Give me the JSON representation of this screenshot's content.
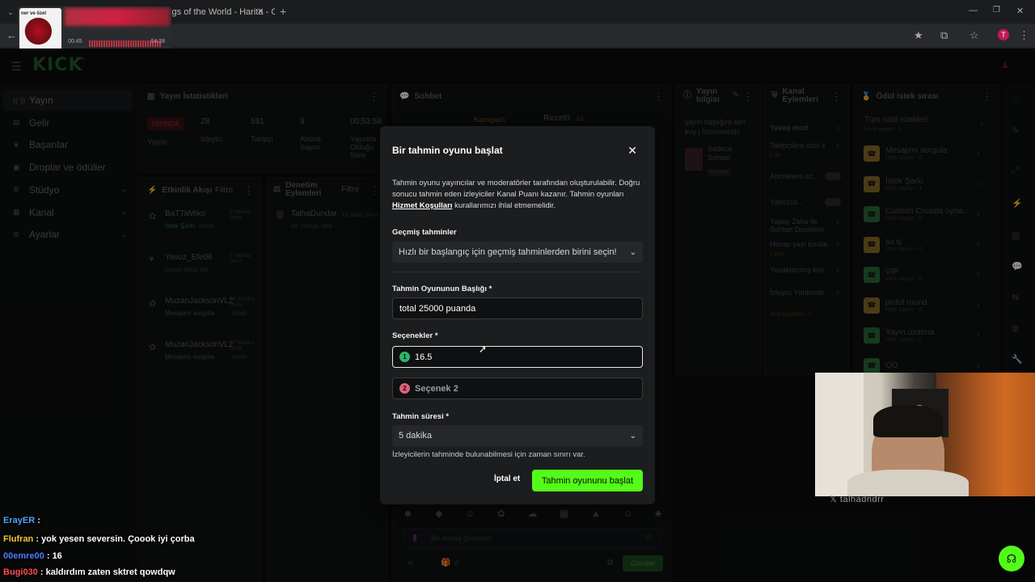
{
  "browser": {
    "tab_title": "lags of the World - Harita - Ga",
    "new_tab": "+",
    "profile_initial": "T"
  },
  "media": {
    "thumb_text": "ner ve özel",
    "time_current": "00:45",
    "time_total": "04:28"
  },
  "app": {
    "logo": "KICK",
    "logo_badge": "beta"
  },
  "sidebar": {
    "items": [
      {
        "label": "Yayın",
        "icon": "broadcast-icon"
      },
      {
        "label": "Gelir",
        "icon": "wallet-icon"
      },
      {
        "label": "Başarılar",
        "icon": "trophy-icon"
      },
      {
        "label": "Droplar ve ödüller",
        "icon": "gift-icon"
      },
      {
        "label": "Stüdyo",
        "icon": "studio-icon"
      },
      {
        "label": "Kanal",
        "icon": "channel-icon"
      },
      {
        "label": "Ayarlar",
        "icon": "gear-icon"
      }
    ]
  },
  "stats": {
    "title": "Yayın İstatistikleri",
    "live_badge": "YAYINDA",
    "live_label": "Yayın",
    "viewers_value": "28",
    "viewers_label": "İzleyici",
    "followers_value": "591",
    "followers_label": "Takipçi",
    "subs_value": "9",
    "subs_label": "Abone Sayısı",
    "uptime_value": "00:53:58",
    "uptime_label": "Yayında Olduğu Süre"
  },
  "activity": {
    "title": "Etkinlik Akışı",
    "filter": "Filtre",
    "items": [
      {
        "user": "BaTTaMiko",
        "time": "6 dakika önce",
        "action": "İstek Şarkı",
        "suffix": "alındı"
      },
      {
        "user": "Yavuz_Efe06",
        "time": "7 dakika önce",
        "action": "kanalı takip etti",
        "suffix": ""
      },
      {
        "user": "MuzanJacksonVL2",
        "time": "46 dakika önce",
        "action": "Mesajımı vurgula",
        "suffix": "alındı"
      },
      {
        "user": "MuzanJacksonVL2",
        "time": "47 dakika önce",
        "action": "Mesajımı vurgula",
        "suffix": "alındı"
      }
    ]
  },
  "moderation": {
    "title": "Denetim Eylemleri",
    "filter": "Filtre",
    "item_user": "TalhaDundar",
    "item_time": "18 saat önce",
    "item_action": "bir mesajı sildi"
  },
  "chat": {
    "title": "Sohbet",
    "user1": "Karogash",
    "user2": "Riccel0",
    "user2_count": "44",
    "input_placeholder": "Bir mesaj gönderin",
    "count": "0",
    "send": "Gönder"
  },
  "stream_info": {
    "title": "Yayın bilgisi",
    "text": "yayın başlığını sen koy | !commands",
    "chat_mode": "Sadece Sohbet",
    "lang": "Turkish"
  },
  "channel_actions": {
    "title": "Kanal Eylemleri",
    "items": [
      "Yavaş mod",
      "Takipçilere özel s",
      "Abonelere öz...",
      "Yalnızca...",
      "Yapay Zeka ile Sohbet Denetimi",
      "Hesap yaşı kısıtla",
      "Yasaklanmış keli",
      "İzleyici Yönlendir"
    ],
    "follower_sub": "1 dk.",
    "age_sub": "1 gün",
    "active_targets": "Aktif hedefler - 1"
  },
  "rewards": {
    "title": "Ödül istek sırası",
    "all_label": "Tüm ödül istekleri",
    "all_count": "İstek sayısı - 3",
    "items": [
      {
        "name": "Mesajımı vurgula",
        "count": "İstek sayısı - 2",
        "color": "#8a6a2a"
      },
      {
        "name": "İstek Şarkı",
        "count": "İstek sayısı - 1",
        "color": "#8a6a2a"
      },
      {
        "name": "Custom Crossla oyna...",
        "count": "İstek sayısı - 0",
        "color": "#2a6a3a"
      },
      {
        "name": "su iç",
        "count": "İstek sayısı - 0",
        "color": "#8a6a2a"
      },
      {
        "name": "VIP",
        "count": "İstek sayısı - 0",
        "color": "#2a6a3a"
      },
      {
        "name": "pistol round",
        "count": "İstek sayısı - 0",
        "color": "#8a6a2a"
      },
      {
        "name": "Yayın uzatma",
        "count": "İstek sayısı - 0",
        "color": "#2a6a3a"
      },
      {
        "name": "OO",
        "count": "",
        "color": "#2a6a3a"
      }
    ]
  },
  "modal": {
    "title": "Bir tahmin oyunu başlat",
    "desc_part1": "Tahmin oyunu yayıncılar ve moderatörler tarafından oluşturulabilir. Doğru sonucu tahmin eden izleyiciler Kanal Puanı kazanır. Tahmin oyunları ",
    "desc_link": "Hizmet Koşulları",
    "desc_part2": " kurallarımızı ihlal etmemelidir.",
    "past_label": "Geçmiş tahminler",
    "past_placeholder": "Hızlı bir başlangıç için geçmiş tahminlerden birini seçin!",
    "title_label": "Tahmin Oyununun Başlığı *",
    "title_value": "total 25000 puanda",
    "options_label": "Seçenekler *",
    "option1_value": "16.5",
    "option1_color": "#2fb56a",
    "option2_placeholder": "Seçenek 2",
    "option2_color": "#e0607a",
    "duration_label": "Tahmin süresi *",
    "duration_value": "5 dakika",
    "duration_hint": "İzleyicilerin tahminde bulunabilmesi için zaman sınırı var.",
    "cancel": "İptal et",
    "start": "Tahmin oyununu başlat",
    "accent": "#53fc18"
  },
  "webcam": {
    "watermark": "talhadndrr"
  },
  "overlay_chat": [
    {
      "user": "ErayER",
      "text": "",
      "color": "#4fa3ff"
    },
    {
      "user": "Flufran",
      "text": "yok yesen seversin. Çoook iyi çorba",
      "color": "#f5c542"
    },
    {
      "user": "00emre00",
      "text": "16",
      "color": "#4f7bff"
    },
    {
      "user": "Bugi030",
      "text": "kaldırdım zaten sktret qowdqw",
      "color": "#ff4f4f"
    }
  ]
}
